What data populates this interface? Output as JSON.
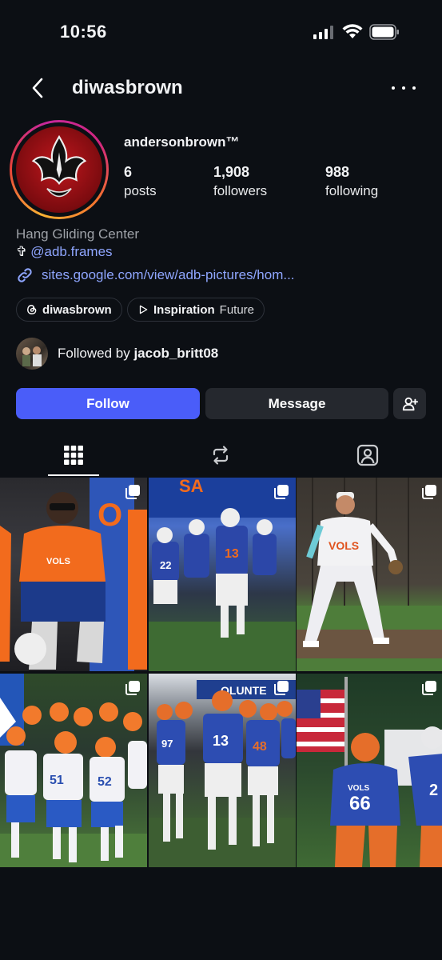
{
  "status": {
    "time": "10:56"
  },
  "header": {
    "username": "diwasbrown"
  },
  "profile": {
    "display_name": "andersonbrown™",
    "stats": [
      {
        "value": "6",
        "label": "posts"
      },
      {
        "value": "1,908",
        "label": "followers"
      },
      {
        "value": "988",
        "label": "following"
      }
    ],
    "category": "Hang Gliding Center",
    "mention_prefix": "✞",
    "mention": "@adb.frames",
    "link": "sites.google.com/view/adb-pictures/hom..."
  },
  "chips": {
    "threads": {
      "label": "diwasbrown"
    },
    "playlist": {
      "label": "Inspiration",
      "sub": "Future"
    }
  },
  "followed_by": {
    "prefix": "Followed by ",
    "user": "jacob_britt08"
  },
  "actions": {
    "follow": "Follow",
    "message": "Message"
  },
  "tabs": [
    {
      "name": "posts-grid",
      "active": true
    },
    {
      "name": "reposts",
      "active": false
    },
    {
      "name": "tagged",
      "active": false
    }
  ],
  "grid": [
    {
      "description": "player in orange VOLS jersey sitting",
      "multi": true
    },
    {
      "description": "team running through tunnel",
      "multi": true
    },
    {
      "description": "baseball player in VOLS uniform",
      "multi": true
    },
    {
      "description": "team charging onto field",
      "multi": true
    },
    {
      "description": "players walking on field at night",
      "multi": true
    },
    {
      "description": "player 66 with american flag",
      "multi": true
    }
  ],
  "colors": {
    "accent": "#4a5df9",
    "link": "#8fa6ff",
    "background": "#0c0f14"
  }
}
